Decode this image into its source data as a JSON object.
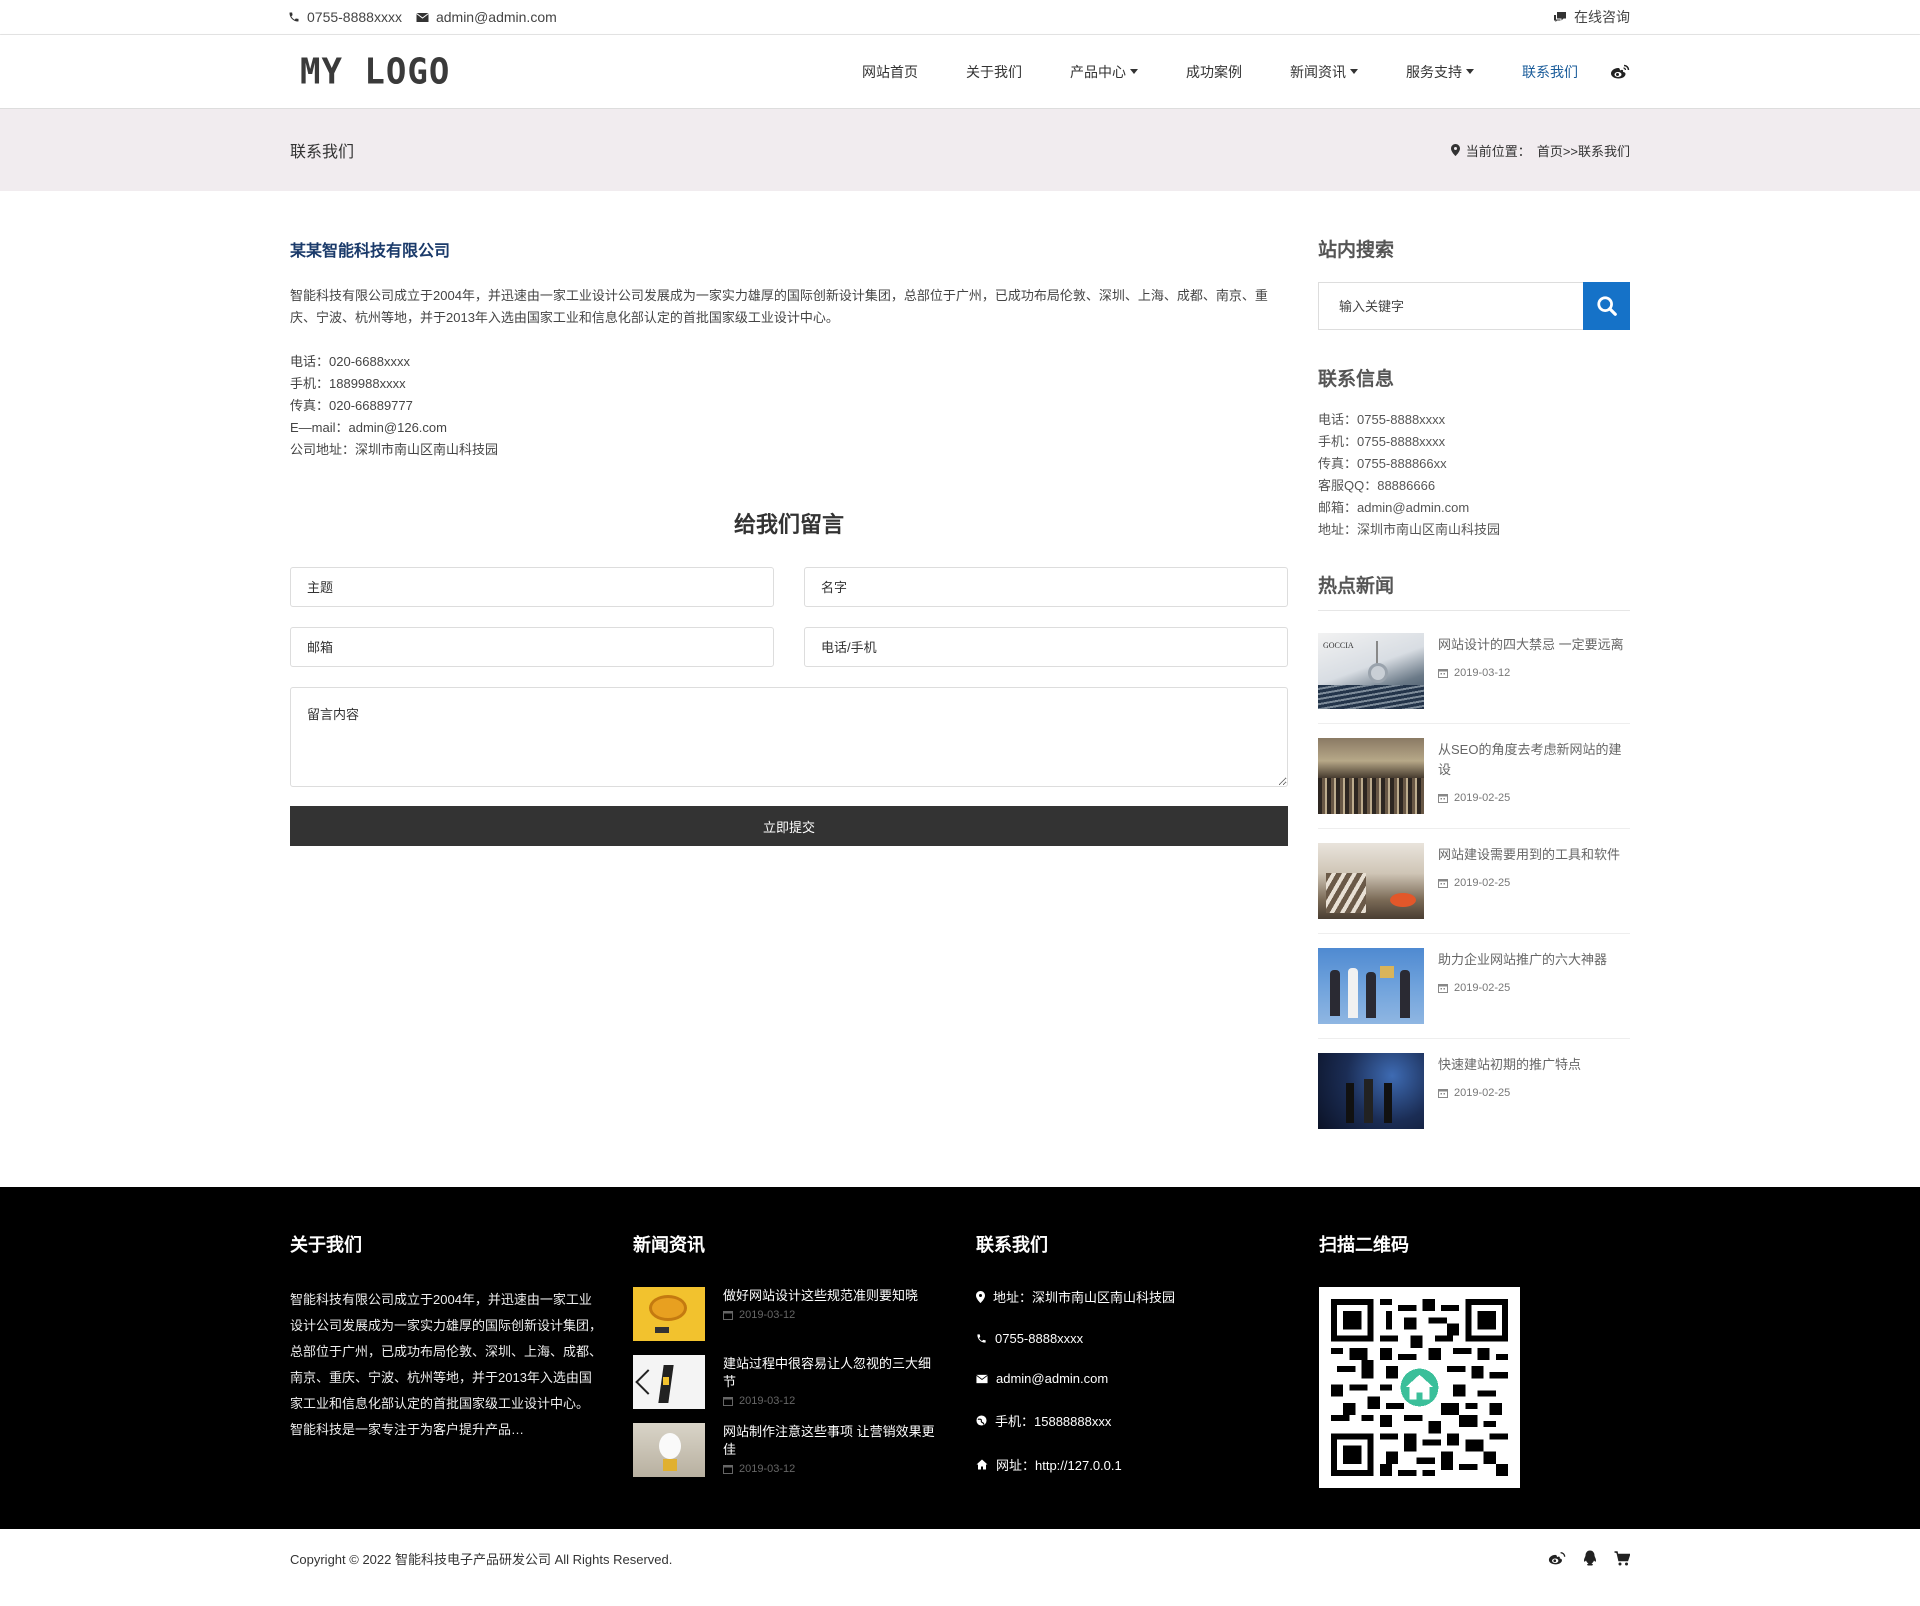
{
  "topbar": {
    "phone": "0755-8888xxxx",
    "email": "admin@admin.com",
    "consult": "在线咨询"
  },
  "header": {
    "logo": "MY LOGO",
    "nav": [
      {
        "label": "网站首页"
      },
      {
        "label": "关于我们"
      },
      {
        "label": "产品中心"
      },
      {
        "label": "成功案例"
      },
      {
        "label": "新闻资讯"
      },
      {
        "label": "服务支持"
      },
      {
        "label": "联系我们"
      }
    ]
  },
  "band": {
    "title": "联系我们",
    "crumb_prefix": "当前位置：",
    "crumb_path": "首页>>联系我们"
  },
  "main": {
    "company": "某某智能科技有限公司",
    "intro": "智能科技有限公司成立于2004年，并迅速由一家工业设计公司发展成为一家实力雄厚的国际创新设计集团，总部位于广州，已成功布局伦敦、深圳、上海、成都、南京、重庆、宁波、杭州等地，并于2013年入选由国家工业和信息化部认定的首批国家级工业设计中心。",
    "info": [
      "电话：020-6688xxxx",
      "手机：1889988xxxx",
      "传真：020-66889777",
      "E—mail：admin@126.com",
      "公司地址：深圳市南山区南山科技园"
    ],
    "form": {
      "title": "给我们留言",
      "subject": "主题",
      "name": "名字",
      "email": "邮箱",
      "phone": "电话/手机",
      "message": "留言内容",
      "submit": "立即提交"
    }
  },
  "side": {
    "search_title": "站内搜索",
    "search_placeholder": "输入关键字",
    "contact_title": "联系信息",
    "contact": [
      "电话：0755-8888xxxx",
      "手机：0755-8888xxxx",
      "传真：0755-888866xx",
      "客服QQ：88886666",
      "邮箱：admin@admin.com",
      "地址：深圳市南山区南山科技园"
    ],
    "hot_title": "热点新闻",
    "hot": [
      {
        "title": "网站设计的四大禁忌 一定要远离",
        "date": "2019-03-12",
        "thumb_text": "GOCCIA"
      },
      {
        "title": "从SEO的角度去考虑新网站的建设",
        "date": "2019-02-25"
      },
      {
        "title": "网站建设需要用到的工具和软件",
        "date": "2019-02-25"
      },
      {
        "title": "助力企业网站推广的六大神器",
        "date": "2019-02-25"
      },
      {
        "title": "快速建站初期的推广特点",
        "date": "2019-02-25"
      }
    ]
  },
  "footer": {
    "about_title": "关于我们",
    "about": "智能科技有限公司成立于2004年，并迅速由一家工业设计公司发展成为一家实力雄厚的国际创新设计集团，总部位于广州，已成功布局伦敦、深圳、上海、成都、南京、重庆、宁波、杭州等地，并于2013年入选由国家工业和信息化部认定的首批国家级工业设计中心。 智能科技是一家专注于为客户提升产品…",
    "news_title": "新闻资讯",
    "news": [
      {
        "title": "做好网站设计这些规范准则要知晓",
        "date": "2019-03-12"
      },
      {
        "title": "建站过程中很容易让人忽视的三大细节",
        "date": "2019-03-12"
      },
      {
        "title": "网站制作注意这些事项 让营销效果更佳",
        "date": "2019-03-12"
      }
    ],
    "contact_title": "联系我们",
    "contact": [
      {
        "icon": "map-marker-icon",
        "text": "地址：深圳市南山区南山科技园"
      },
      {
        "icon": "phone-icon",
        "text": "0755-8888xxxx"
      },
      {
        "icon": "envelope-icon",
        "text": "admin@admin.com"
      },
      {
        "icon": "globe-icon",
        "text": "手机：15888888xxx"
      },
      {
        "icon": "home-icon",
        "text": "网址：http://127.0.0.1"
      }
    ],
    "qr_title": "扫描二维码"
  },
  "copyright": "Copyright © 2022 智能科技电子产品研发公司 All Rights Reserved.",
  "colors": {
    "accent": "#1572c8",
    "nav_active": "#1a5c9a",
    "footer_bg": "#000000",
    "band_bg": "#f1ecef",
    "submit_bg": "#333333"
  }
}
